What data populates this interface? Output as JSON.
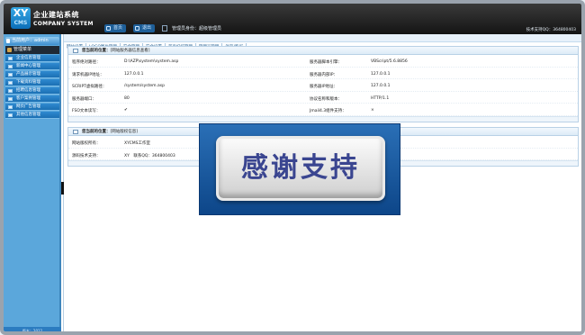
{
  "header": {
    "logo_mark": "XY",
    "logo_sub": "CMS",
    "brand_cn": "企业建站系统",
    "brand_en": "COMPANY SYSTEM",
    "btn_home": "首页",
    "btn_exit": "退出",
    "identity": "管理员身份：超级管理员",
    "support": "技术支持QQ：364800403"
  },
  "sidebar": {
    "user": "当前用户：admin",
    "menu_title": "管理菜单",
    "items": [
      "企业信息管理",
      "新闻中心管理",
      "产品展示管理",
      "下载资料管理",
      "招聘信息管理",
      "客户案例管理",
      "网页广告管理",
      "其他信息管理"
    ],
    "footer": "版本：2012"
  },
  "tabs": [
    "网站设置",
    "LOGO图片管理",
    "安全管理",
    "安全设置",
    "首页幻灯管理",
    "管理员管理",
    "外链/购买"
  ],
  "server_panel": {
    "title_bold": "您当前的位置：",
    "title_rest": "[网站服务器信息查看]",
    "rows": [
      {
        "l1": "程序绝对路径：",
        "v1": "D:\\AZP\\system\\system.asp",
        "l2": "服务器脚本引擎：",
        "v2": "VBScript/5.6.8856"
      },
      {
        "l1": "请求机器IP地址：",
        "v1": "127.0.0.1",
        "l2": "服务器内部IP：",
        "v2": "127.0.0.1"
      },
      {
        "l1": "SCRIPT虚拟路径：",
        "v1": "/system/system.asp",
        "l2": "服务器IP地址：",
        "v2": "127.0.0.1"
      },
      {
        "l1": "服务器端口：",
        "v1": "80",
        "l2": "协议名称和版本：",
        "v2": "HTTP/1.1"
      },
      {
        "l1": "FSO文本读写：",
        "v1": "✔",
        "l2": "Jmail4.3组件支持：",
        "v2": "×"
      }
    ]
  },
  "copyright_panel": {
    "title_bold": "您当前的位置：",
    "title_rest": "[网站版权信息]",
    "rows": [
      {
        "l1": "网站版权所有：",
        "v1": "XYCMS工作室"
      },
      {
        "l1": "源码技术支持：",
        "v1": "XY　联系QQ：364800403"
      }
    ]
  },
  "ad": {
    "text": "感谢支持"
  }
}
